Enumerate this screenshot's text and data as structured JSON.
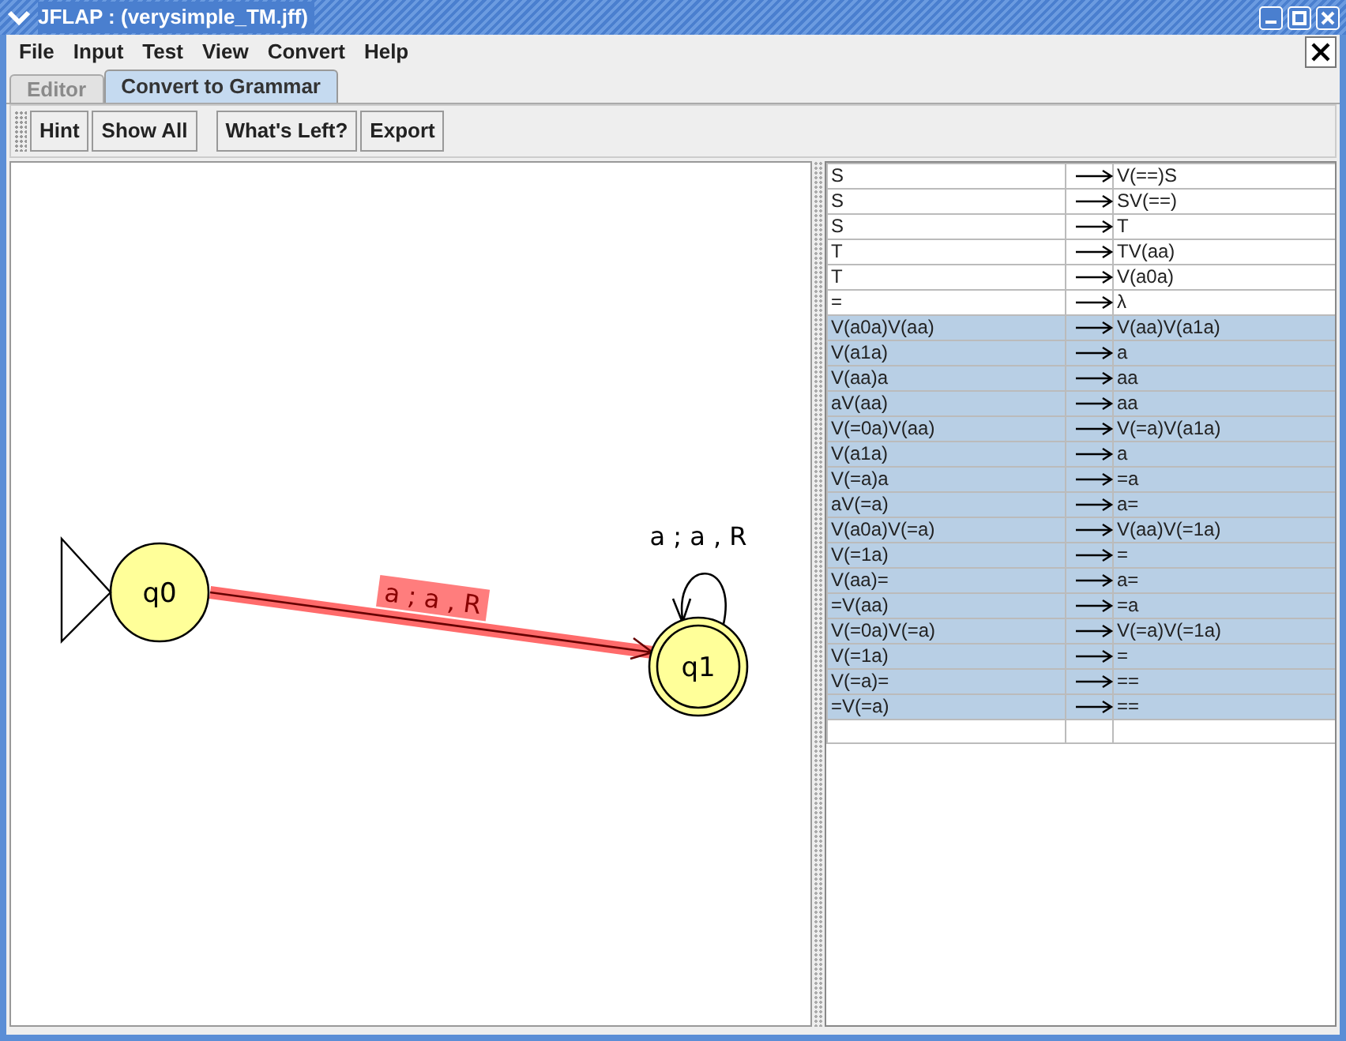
{
  "window": {
    "title": "JFLAP : (verysimple_TM.jff)"
  },
  "menu": [
    "File",
    "Input",
    "Test",
    "View",
    "Convert",
    "Help"
  ],
  "tabs": [
    {
      "label": "Editor",
      "selected": false
    },
    {
      "label": "Convert to Grammar",
      "selected": true
    }
  ],
  "toolbar": [
    "Hint",
    "Show All",
    "What's Left?",
    "Export"
  ],
  "automaton": {
    "states": [
      {
        "label": "q0",
        "initial": true,
        "final": false
      },
      {
        "label": "q1",
        "initial": false,
        "final": true
      }
    ],
    "transitions": [
      {
        "label": "a ; a , R",
        "selected": true
      },
      {
        "label": "a ; a , R",
        "selected": false
      }
    ]
  },
  "productions": [
    {
      "lhs": "S",
      "rhs": "V(==)S",
      "selected": false
    },
    {
      "lhs": "S",
      "rhs": "SV(==)",
      "selected": false
    },
    {
      "lhs": "S",
      "rhs": "T",
      "selected": false
    },
    {
      "lhs": "T",
      "rhs": "TV(aa)",
      "selected": false
    },
    {
      "lhs": "T",
      "rhs": "V(a0a)",
      "selected": false
    },
    {
      "lhs": "=",
      "rhs": "λ",
      "selected": false
    },
    {
      "lhs": "V(a0a)V(aa)",
      "rhs": "V(aa)V(a1a)",
      "selected": true
    },
    {
      "lhs": "V(a1a)",
      "rhs": "a",
      "selected": true
    },
    {
      "lhs": "V(aa)a",
      "rhs": "aa",
      "selected": true
    },
    {
      "lhs": "aV(aa)",
      "rhs": "aa",
      "selected": true
    },
    {
      "lhs": "V(=0a)V(aa)",
      "rhs": "V(=a)V(a1a)",
      "selected": true
    },
    {
      "lhs": "V(a1a)",
      "rhs": "a",
      "selected": true
    },
    {
      "lhs": "V(=a)a",
      "rhs": "=a",
      "selected": true
    },
    {
      "lhs": "aV(=a)",
      "rhs": "a=",
      "selected": true
    },
    {
      "lhs": "V(a0a)V(=a)",
      "rhs": "V(aa)V(=1a)",
      "selected": true
    },
    {
      "lhs": "V(=1a)",
      "rhs": "=",
      "selected": true
    },
    {
      "lhs": "V(aa)=",
      "rhs": "a=",
      "selected": true
    },
    {
      "lhs": "=V(aa)",
      "rhs": "=a",
      "selected": true
    },
    {
      "lhs": "V(=0a)V(=a)",
      "rhs": "V(=a)V(=1a)",
      "selected": true
    },
    {
      "lhs": "V(=1a)",
      "rhs": "=",
      "selected": true
    },
    {
      "lhs": "V(=a)=",
      "rhs": "==",
      "selected": true
    },
    {
      "lhs": "=V(=a)",
      "rhs": "==",
      "selected": true
    }
  ]
}
